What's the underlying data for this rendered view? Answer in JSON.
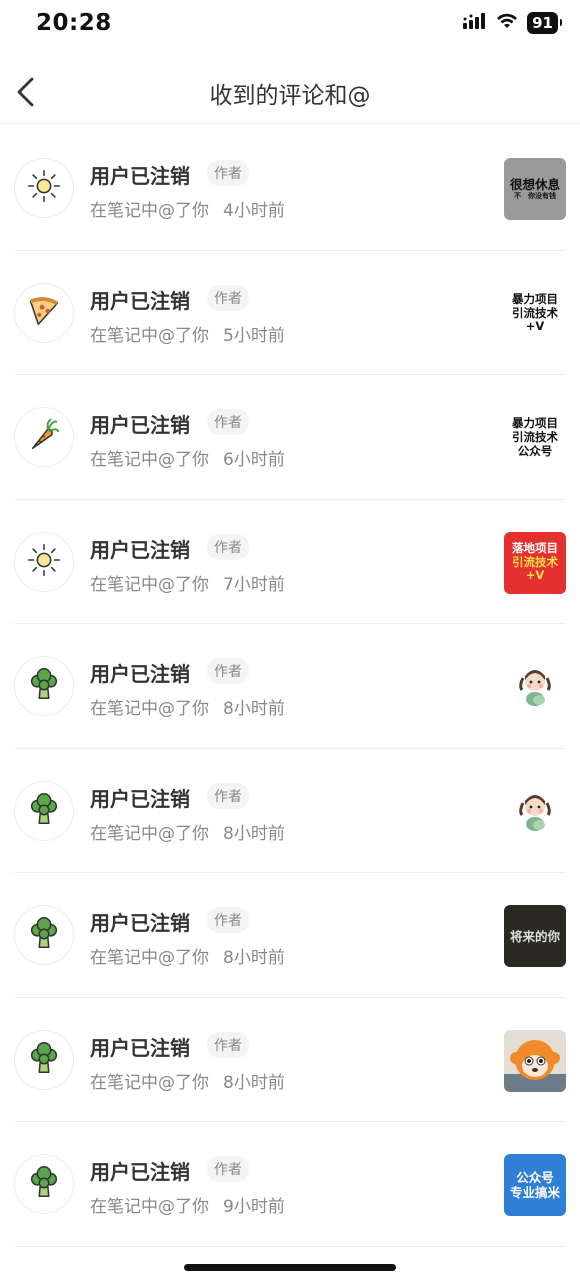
{
  "status_bar": {
    "time": "20:28",
    "battery": "91"
  },
  "nav": {
    "title": "收到的评论和@"
  },
  "items": [
    {
      "name": "用户已注销",
      "badge": "作者",
      "action": "在笔记中@了你",
      "time": "4小时前",
      "avatar_icon": "sun-icon",
      "thumb": {
        "kind": "text",
        "lines": [
          "很想休息",
          "不　你没有钱"
        ],
        "bg": "#9a9a9a",
        "fg": "#111111"
      }
    },
    {
      "name": "用户已注销",
      "badge": "作者",
      "action": "在笔记中@了你",
      "time": "5小时前",
      "avatar_icon": "pizza-icon",
      "thumb": {
        "kind": "text",
        "lines": [
          "暴力项目",
          "引流技术",
          "+V"
        ],
        "bg": "#ffffff",
        "fg": "#111111"
      }
    },
    {
      "name": "用户已注销",
      "badge": "作者",
      "action": "在笔记中@了你",
      "time": "6小时前",
      "avatar_icon": "carrot-icon",
      "thumb": {
        "kind": "text",
        "lines": [
          "暴力项目",
          "引流技术",
          "公众号"
        ],
        "bg": "#ffffff",
        "fg": "#111111"
      }
    },
    {
      "name": "用户已注销",
      "badge": "作者",
      "action": "在笔记中@了你",
      "time": "7小时前",
      "avatar_icon": "sun-icon",
      "thumb": {
        "kind": "text",
        "lines": [
          "落地项目",
          "引流技术",
          "+V"
        ],
        "bg": "#e53030",
        "fg": "#ffffff"
      }
    },
    {
      "name": "用户已注销",
      "badge": "作者",
      "action": "在笔记中@了你",
      "time": "8小时前",
      "avatar_icon": "broccoli-icon",
      "thumb": {
        "kind": "girl"
      }
    },
    {
      "name": "用户已注销",
      "badge": "作者",
      "action": "在笔记中@了你",
      "time": "8小时前",
      "avatar_icon": "broccoli-icon",
      "thumb": {
        "kind": "girl"
      }
    },
    {
      "name": "用户已注销",
      "badge": "作者",
      "action": "在笔记中@了你",
      "time": "8小时前",
      "avatar_icon": "broccoli-icon",
      "thumb": {
        "kind": "text",
        "lines": [
          "将来的你"
        ],
        "bg": "#2a2a22",
        "fg": "#dddddd"
      }
    },
    {
      "name": "用户已注销",
      "badge": "作者",
      "action": "在笔记中@了你",
      "time": "8小时前",
      "avatar_icon": "broccoli-icon",
      "thumb": {
        "kind": "monkey"
      }
    },
    {
      "name": "用户已注销",
      "badge": "作者",
      "action": "在笔记中@了你",
      "time": "9小时前",
      "avatar_icon": "broccoli-icon",
      "thumb": {
        "kind": "text",
        "lines": [
          "公众号",
          "专业搞米"
        ],
        "bg": "#2f7fd6",
        "fg": "#ffffff"
      }
    }
  ]
}
